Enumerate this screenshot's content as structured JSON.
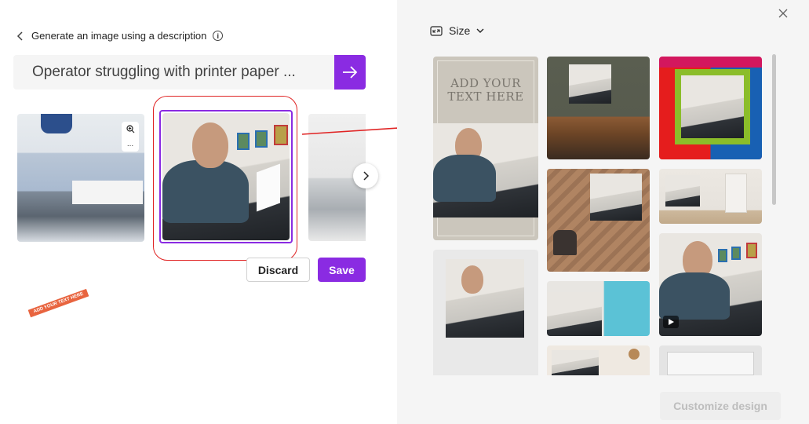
{
  "header": {
    "back_label": "Generate an image using a description",
    "info_icon": "info-icon"
  },
  "prompt": {
    "value": "Operator struggling with printer paper ...",
    "submit_icon": "arrow-right-icon"
  },
  "carousel": {
    "next_icon": "chevron-right-icon",
    "zoom_icon": "zoom-in-icon",
    "more_icon": "more-options-icon",
    "more_label": "..."
  },
  "actions": {
    "discard_label": "Discard",
    "save_label": "Save"
  },
  "panel": {
    "size_label": "Size",
    "close_icon": "close-icon",
    "template_text": "ADD YOUR TEXT HERE",
    "banner_text": "ADD YOUR TEXT HERE",
    "customize_label": "Customize design"
  },
  "colors": {
    "accent": "#8a2be2",
    "annotation": "#e02424"
  }
}
